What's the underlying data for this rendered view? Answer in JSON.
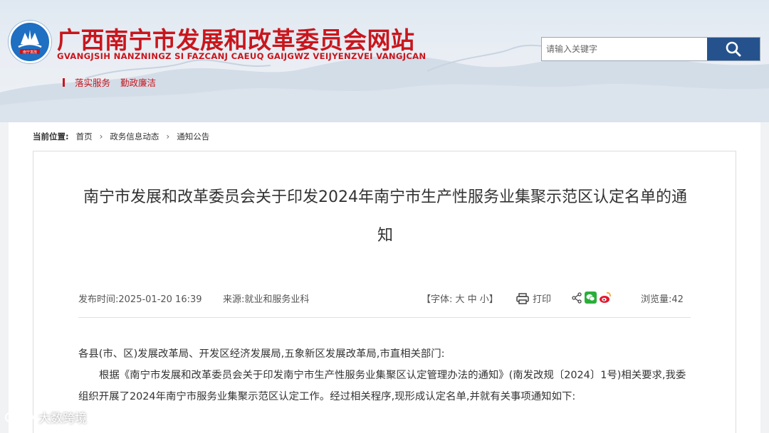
{
  "header": {
    "site_title": "广西南宁市发展和改革委员会网站",
    "site_subtitle": "GVANGJSIH NANZNINGZ SI FAZCANJ CAEUQ GAIJGWZ VEIJYENZVEI VANGJCAN",
    "logo_text": "南宁发改",
    "search_placeholder": "请输入关键字",
    "nav": [
      "落实服务",
      "勤政廉洁"
    ]
  },
  "breadcrumb": {
    "label": "当前位置:",
    "items": [
      "首页",
      "政务信息动态",
      "通知公告"
    ]
  },
  "article": {
    "title": "南宁市发展和改革委员会关于印发2024年南宁市生产性服务业集聚示范区认定名单的通知",
    "publish_time": "发布时间:2025-01-20 16:39",
    "source": "来源:就业和服务业科",
    "font_size_label": "【字体: 大 中 小】",
    "print_label": "打印",
    "views": "浏览量:42",
    "paragraphs": [
      "各县(市、区)发展改革局、开发区经济发展局,五象新区发展改革局,市直相关部门:",
      "根据《南宁市发展和改革委员会关于印发南宁市生产性服务业集聚区认定管理办法的通知》(南发改规〔2024〕1号)相关要求,我委组织开展了2024年南宁市服务业集聚示范区认定工作。经过相关程序,现形成认定名单,并就有关事项通知如下:"
    ]
  },
  "watermark": "大数跨境",
  "colors": {
    "brand_red": "#c8161d",
    "search_blue": "#25528c",
    "logo_blue": "#1f6fc2"
  }
}
